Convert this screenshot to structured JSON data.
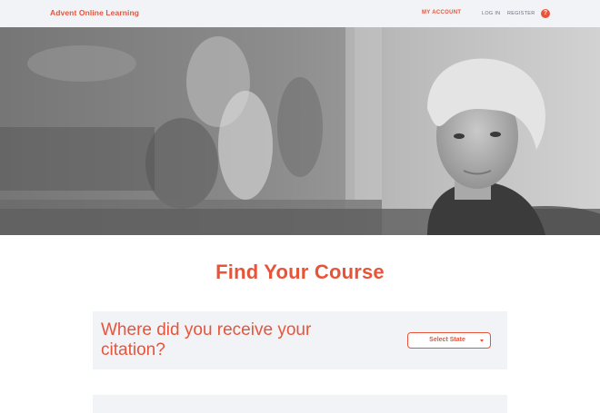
{
  "header": {
    "brand": "Advent Online Learning",
    "nav": {
      "my_account": "MY ACCOUNT",
      "login": "LOG IN",
      "register": "REGISTER",
      "help_icon_glyph": "?"
    }
  },
  "hero": {
    "image_icon": "hero-photo-woman"
  },
  "main": {
    "title": "Find Your Course",
    "question": {
      "text": "Where did you receive your citation?",
      "select": {
        "selected": "Select State"
      }
    }
  },
  "colors": {
    "accent": "#e8543a",
    "panel": "#f1f3f7",
    "muted_text": "#6b6f78"
  }
}
